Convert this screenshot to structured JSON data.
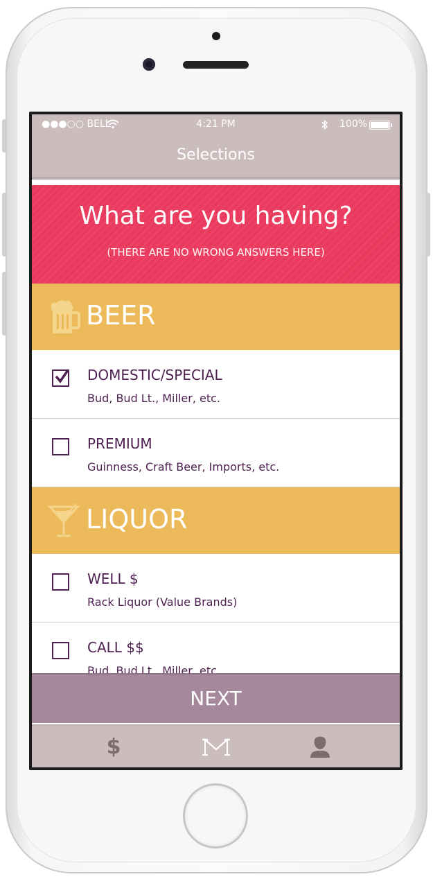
{
  "status_bar": {
    "carrier": "●●●○○ BELL",
    "time": "4:21 PM",
    "bluetooth": "bluetooth-icon",
    "battery": "100%"
  },
  "nav": {
    "title": "Selections"
  },
  "hero": {
    "title": "What are you having?",
    "subtitle": "(THERE ARE NO WRONG ANSWERS HERE)"
  },
  "categories": [
    {
      "label": "BEER",
      "icon": "beer-mug-icon",
      "items": [
        {
          "title": "DOMESTIC/SPECIAL",
          "subtitle": "Bud, Bud Lt., Miller, etc.",
          "checked": true
        },
        {
          "title": "PREMIUM",
          "subtitle": "Guinness, Craft Beer, Imports, etc.",
          "checked": false
        }
      ]
    },
    {
      "label": "LIQUOR",
      "icon": "martini-glass-icon",
      "items": [
        {
          "title": "WELL $",
          "subtitle": "Rack Liquor (Value Brands)",
          "checked": false
        },
        {
          "title": "CALL $$",
          "subtitle": "Bud, Bud Lt., Miller, etc.",
          "checked": false
        }
      ]
    }
  ],
  "next_button": {
    "label": "NEXT"
  },
  "tab_bar": {
    "tabs": [
      {
        "name": "payment",
        "icon": "dollar-icon",
        "glyph": "$"
      },
      {
        "name": "home",
        "icon": "m-logo-icon"
      },
      {
        "name": "profile",
        "icon": "user-icon"
      }
    ]
  },
  "colors": {
    "hero": "#ea3a5e",
    "category": "#ecba5a",
    "text": "#4e2150",
    "nav": "#cbbcbd",
    "next": "#a5889b"
  }
}
